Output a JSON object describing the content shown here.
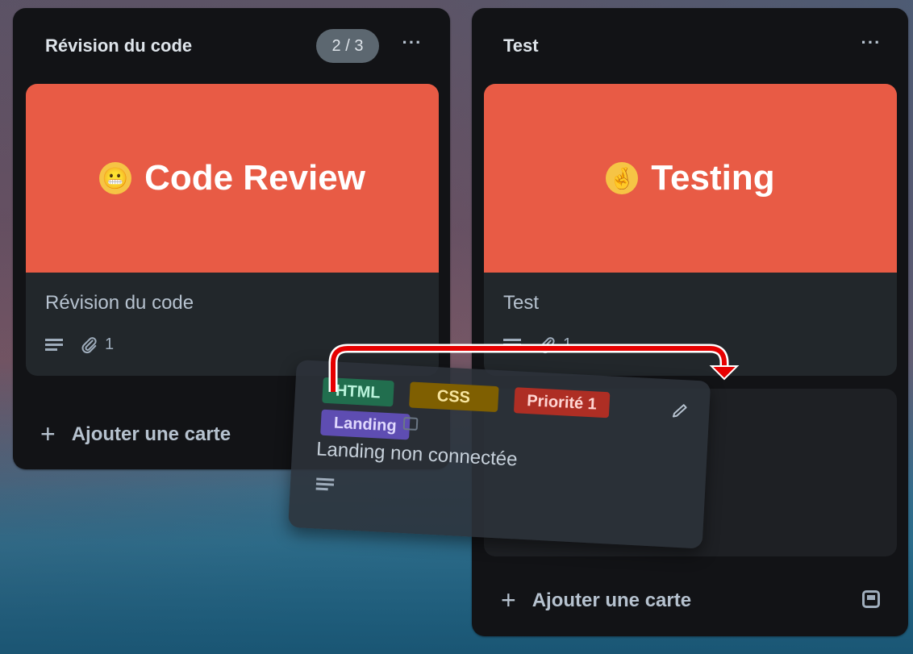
{
  "lists": [
    {
      "title": "Révision du code",
      "badge": "2 / 3",
      "more": "···",
      "card": {
        "cover_text": "Code Review",
        "cover_emoji": "😬",
        "title": "Révision du code",
        "attachments": "1"
      },
      "add_card": "Ajouter une carte"
    },
    {
      "title": "Test",
      "more": "···",
      "card": {
        "cover_text": "Testing",
        "cover_emoji": "🤞",
        "title": "Test",
        "attachments": "1"
      },
      "add_card": "Ajouter une carte"
    }
  ],
  "dragged_card": {
    "labels": [
      {
        "text": "HTML",
        "color": "#216e4e"
      },
      {
        "text": "CSS",
        "color": "#7f5f01"
      },
      {
        "text": "Priorité 1",
        "color": "#ae2e24"
      },
      {
        "text": "Landing",
        "color": "#5e4db2"
      }
    ],
    "title": "Landing non connectée"
  },
  "colors": {
    "cover": "#e85b45",
    "list_bg": "#121316",
    "card_bg": "#22272b",
    "arrow": "#e60000"
  }
}
